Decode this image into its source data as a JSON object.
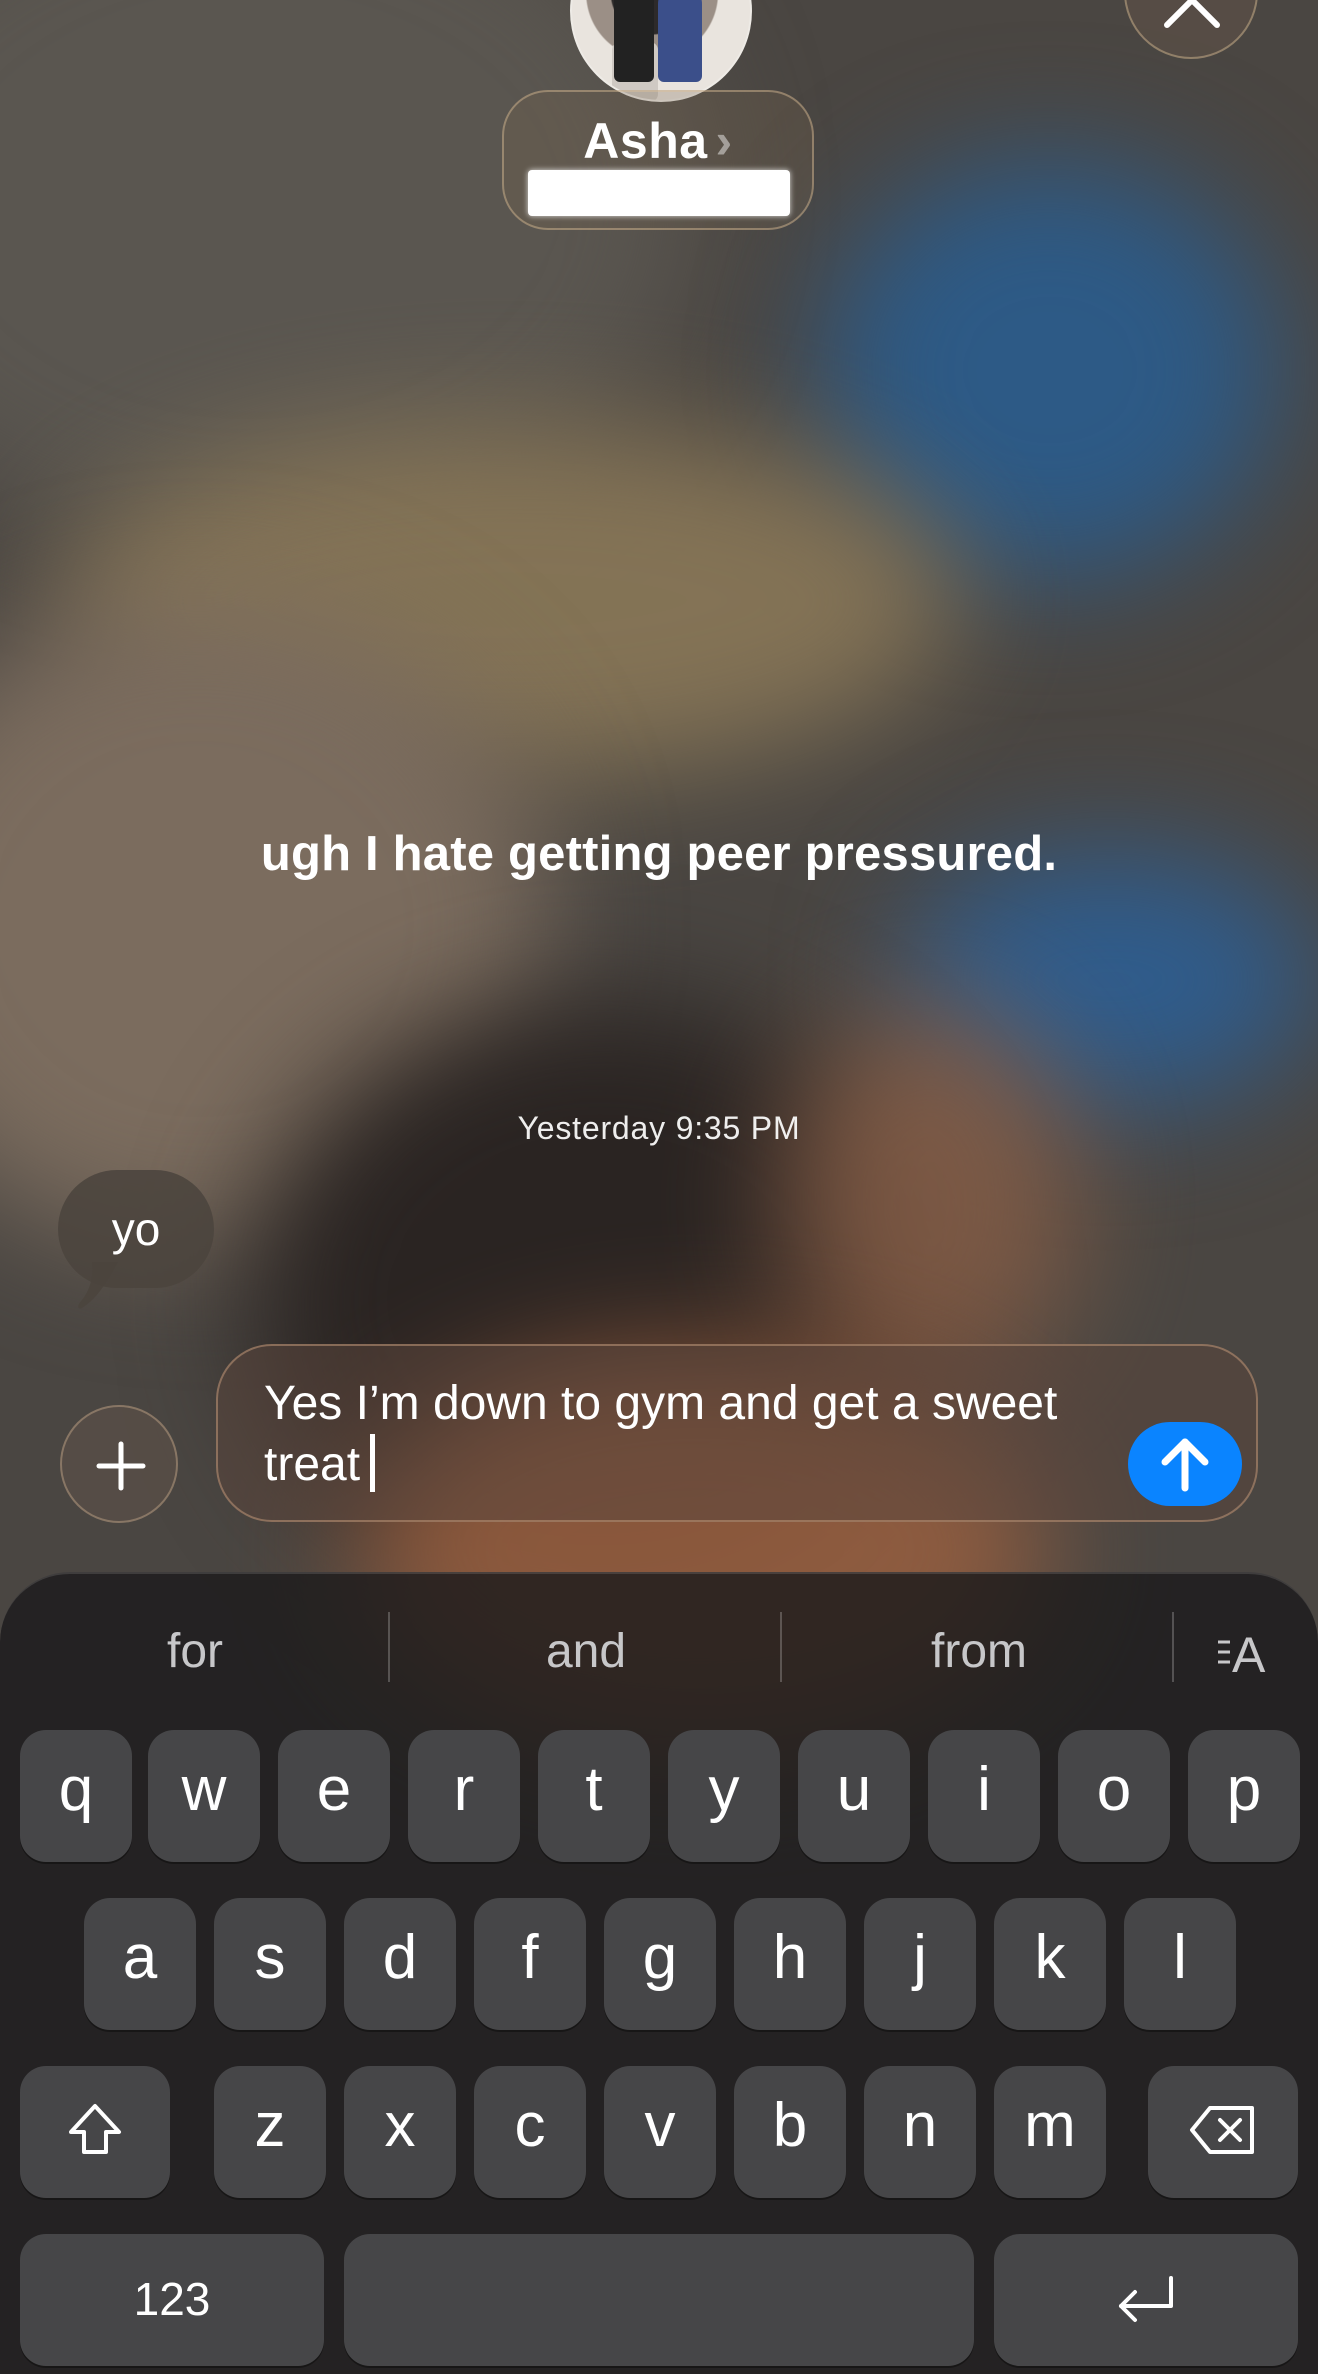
{
  "header": {
    "contact_name": "Asha",
    "chevron": "›"
  },
  "story": {
    "caption": "ugh I hate getting peer pressured."
  },
  "conversation": {
    "timestamp_day": "Yesterday",
    "timestamp_time": "9:35 PM",
    "messages": [
      {
        "sender": "them",
        "text": "yo"
      }
    ]
  },
  "composer": {
    "text": "Yes I’m down to gym and get a sweet treat",
    "send_color": "#0a84ff"
  },
  "keyboard": {
    "suggestions": [
      "for",
      "and",
      "from"
    ],
    "row1": [
      "q",
      "w",
      "e",
      "r",
      "t",
      "y",
      "u",
      "i",
      "o",
      "p"
    ],
    "row2": [
      "a",
      "s",
      "d",
      "f",
      "g",
      "h",
      "j",
      "k",
      "l"
    ],
    "row3": [
      "z",
      "x",
      "c",
      "v",
      "b",
      "n",
      "m"
    ],
    "numbers_key": "123"
  },
  "icons": [
    "close-icon",
    "plus-icon",
    "send-arrow-icon",
    "shift-icon",
    "delete-icon",
    "return-icon",
    "text-format-icon"
  ]
}
